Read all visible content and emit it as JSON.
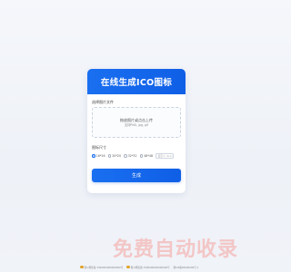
{
  "card": {
    "title": "在线生成ICO图标",
    "select_label": "选择图片文件",
    "upload": {
      "main_text": "拖放图片或点击上传",
      "sub_text": "支持PNG, jpg, gif"
    },
    "size_label": "图标尺寸",
    "sizes": [
      {
        "label": "16*16",
        "checked": true
      },
      {
        "label": "20*20",
        "checked": false
      },
      {
        "label": "32*32",
        "checked": false
      },
      {
        "label": "48*48",
        "checked": false
      }
    ],
    "custom_placeholder": "自定义 (0-x)",
    "generate_label": "生成"
  },
  "watermark": "免费自动收录",
  "footer": {
    "items": [
      {
        "icon": "police-badge-icon",
        "text": "浙公网安备 3300000000000000号"
      },
      {
        "icon": "police-badge-icon",
        "text": "浙公网安备 3300000000000000号"
      },
      {
        "icon": "",
        "text": "浙ICP备00000000号-1"
      }
    ]
  },
  "colors": {
    "accent": "#1a6ff0",
    "watermark": "#f3c6c6"
  }
}
